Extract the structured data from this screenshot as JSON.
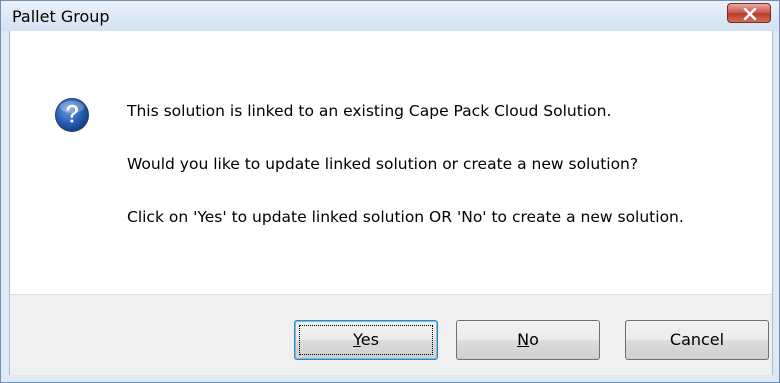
{
  "window": {
    "title": "Pallet Group"
  },
  "message": {
    "line1": "This solution is linked to an existing Cape Pack Cloud Solution.",
    "line2": "Would you like to update linked solution or create a new solution?",
    "line3": "Click on 'Yes' to update linked solution OR 'No' to create a new solution."
  },
  "buttons": {
    "yes": {
      "mnemonic": "Y",
      "rest": "es"
    },
    "no": {
      "mnemonic": "N",
      "rest": "o"
    },
    "cancel": {
      "label": "Cancel"
    }
  },
  "icons": {
    "titlebar_close": "close-icon",
    "message_type": "question-icon"
  },
  "colors": {
    "titlebar": "#d3e1f1",
    "close_button": "#c75050",
    "question_icon": "#2a5fb4",
    "button_bar": "#f0f0f0"
  }
}
